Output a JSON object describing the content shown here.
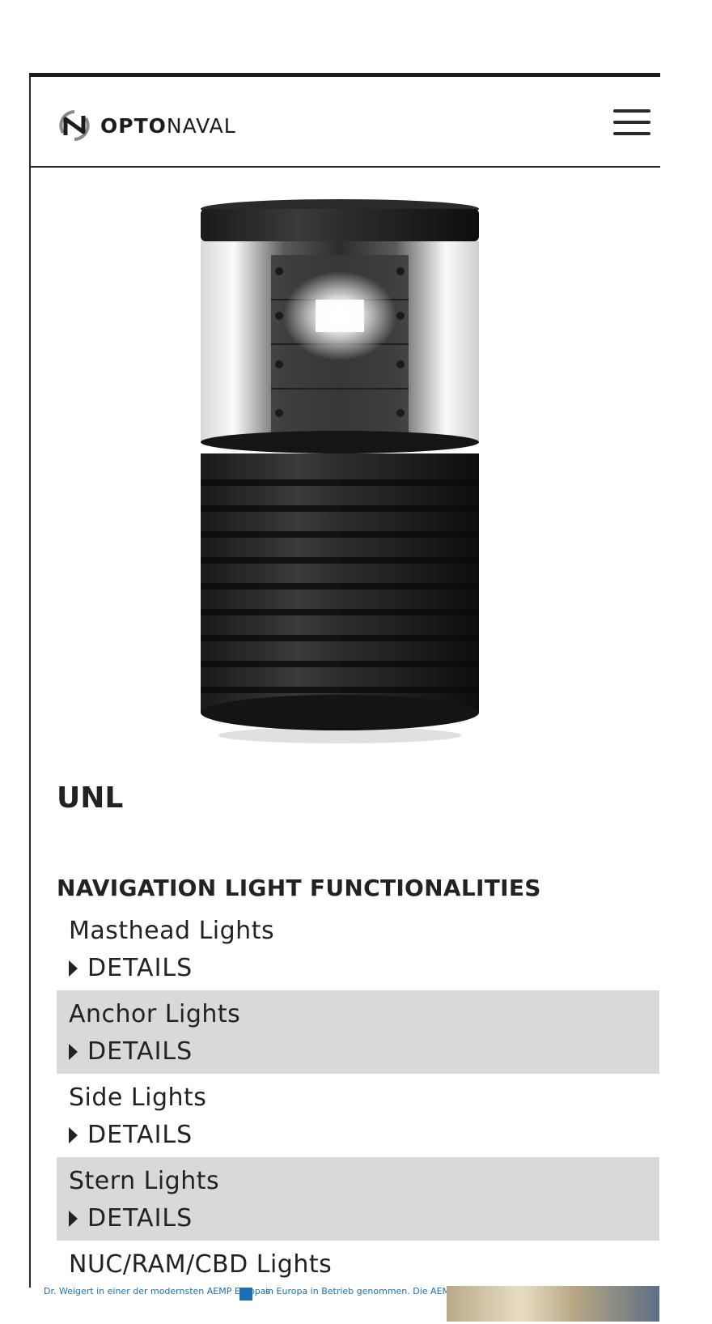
{
  "header": {
    "logo": {
      "text_bold": "OPTO",
      "text_regular": "NAVAL",
      "icon": "optonaval-logo-icon"
    },
    "menu_icon": "hamburger-menu-icon"
  },
  "product": {
    "image_icon": "navigation-light-product-image",
    "title": "UNL"
  },
  "functionalities": {
    "heading": "NAVIGATION LIGHT FUNCTIONALITIES",
    "details_label": "DETAILS",
    "items": [
      {
        "name": "Masthead Lights",
        "details": "DETAILS"
      },
      {
        "name": "Anchor Lights",
        "details": "DETAILS"
      },
      {
        "name": "Side Lights",
        "details": "DETAILS"
      },
      {
        "name": "Stern Lights",
        "details": "DETAILS"
      },
      {
        "name": "NUC/RAM/CBD Lights"
      }
    ]
  },
  "bottom_strip": {
    "left_text": "Dr. Weigert in einer der modernsten AEMP Europas",
    "middle_text": "in Europa in Betrieb genommen. Die AEMP"
  },
  "colors": {
    "accent_dark": "#1b1b1b",
    "row_shade": "#d9d9d9",
    "link_blue": "#1a6fb5"
  }
}
